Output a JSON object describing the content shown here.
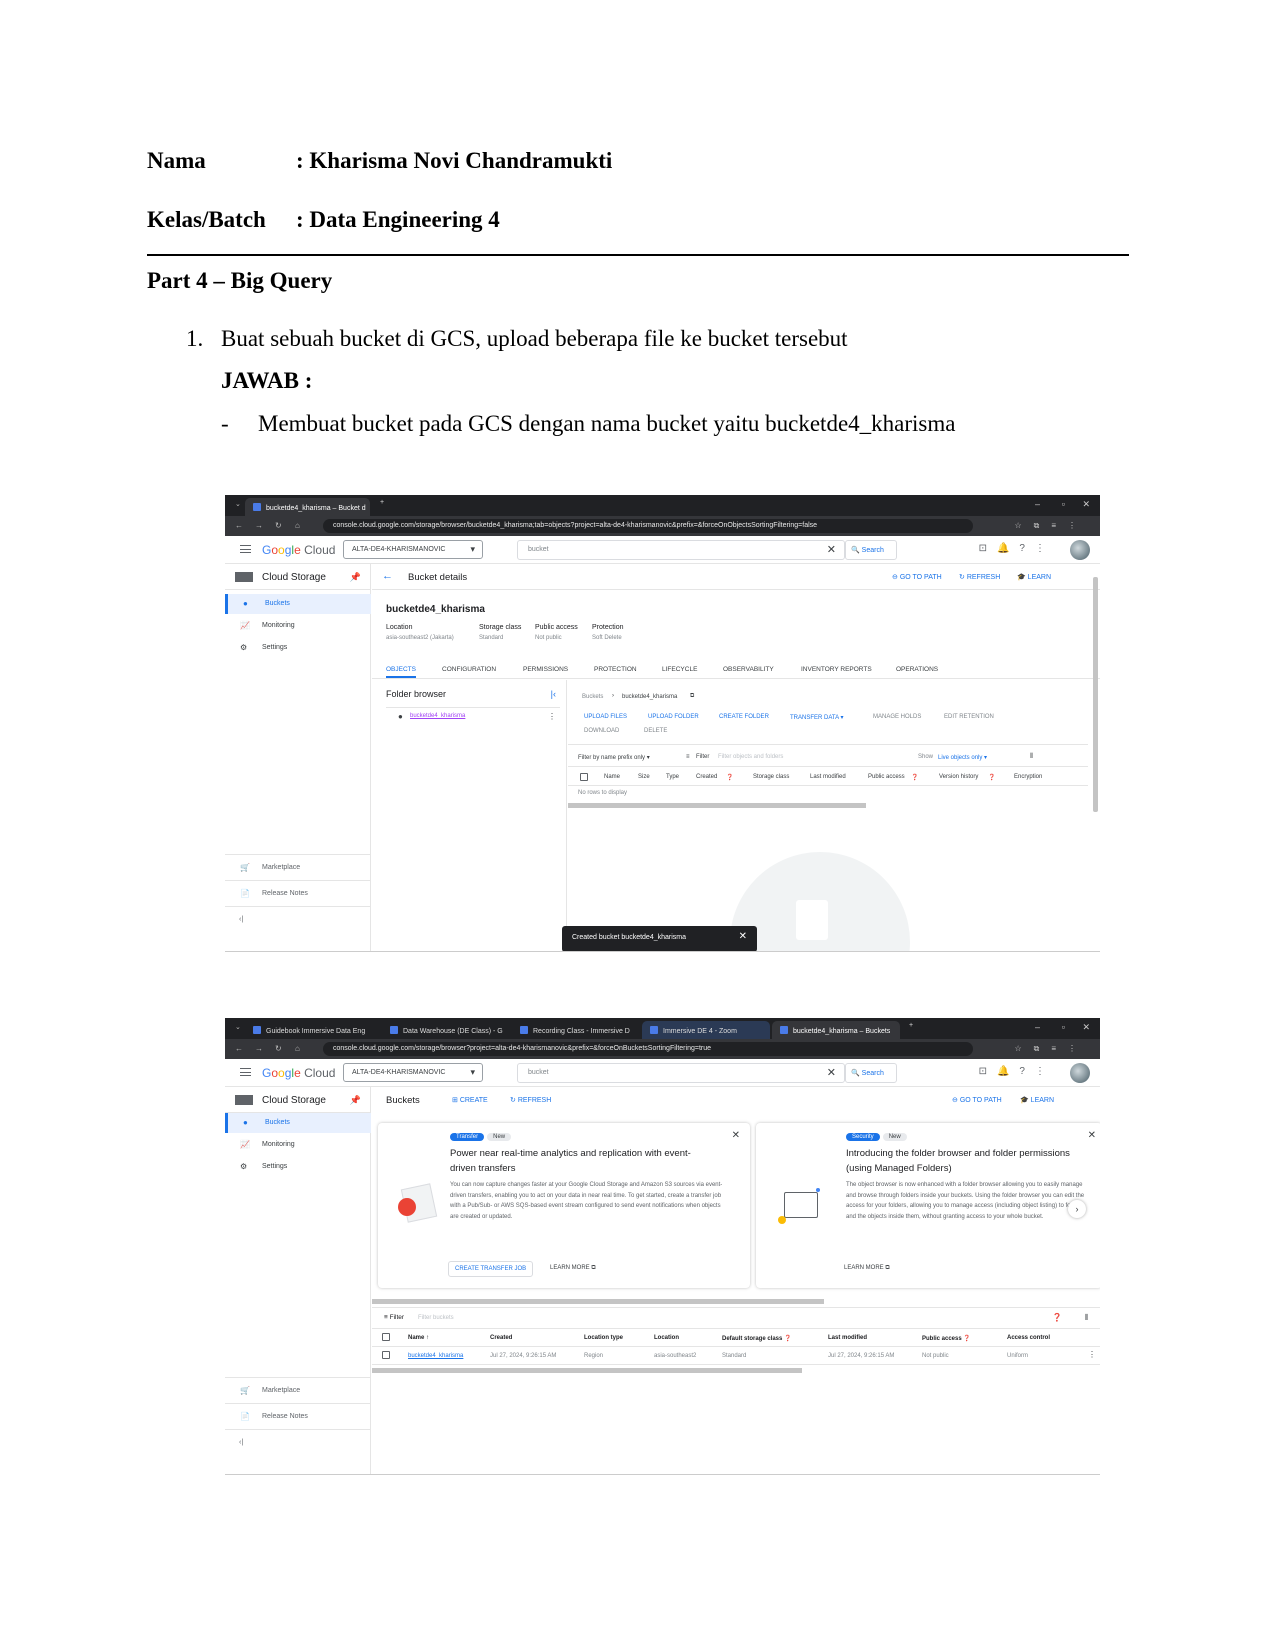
{
  "doc": {
    "nama_label": "Nama",
    "nama_value": ": Kharisma Novi Chandramukti",
    "kelas_label": "Kelas/Batch",
    "kelas_value": ": Data Engineering 4",
    "part_title": "Part 4 – Big Query",
    "item1_number": "1.",
    "item1_text": "Buat sebuah bucket di GCS, upload beberapa file ke bucket tersebut",
    "jawab": "JAWAB :",
    "bullet_dash": "-",
    "bullet_text": "Membuat bucket pada GCS dengan nama bucket yaitu bucketde4_kharisma"
  },
  "shot1": {
    "tab_title": "bucketde4_kharisma – Bucket d",
    "url": "console.cloud.google.com/storage/browser/bucketde4_kharisma;tab=objects?project=alta-de4-kharismanovic&prefix=&forceOnObjectsSortingFiltering=false",
    "project": "ALTA-DE4-KHARISMANOVIC",
    "search_placeholder": "bucket",
    "search_button": "Search",
    "product": "Cloud Storage",
    "nav": [
      "Buckets",
      "Monitoring",
      "Settings"
    ],
    "footer": [
      "Marketplace",
      "Release Notes"
    ],
    "page_title": "Bucket details",
    "goto_path": "GO TO PATH",
    "refresh": "REFRESH",
    "learn": "LEARN",
    "bucket_name": "bucketde4_kharisma",
    "props": [
      {
        "label": "Location",
        "value": "asia-southeast2 (Jakarta)"
      },
      {
        "label": "Storage class",
        "value": "Standard"
      },
      {
        "label": "Public access",
        "value": "Not public"
      },
      {
        "label": "Protection",
        "value": "Soft Delete"
      }
    ],
    "tabs": [
      "OBJECTS",
      "CONFIGURATION",
      "PERMISSIONS",
      "PROTECTION",
      "LIFECYCLE",
      "OBSERVABILITY",
      "INVENTORY REPORTS",
      "OPERATIONS"
    ],
    "folder_browser": "Folder browser",
    "folder_item": "bucketde4_kharisma",
    "breadcrumb_root": "Buckets",
    "breadcrumb_bucket": "bucketde4_kharisma",
    "actions": [
      "UPLOAD FILES",
      "UPLOAD FOLDER",
      "CREATE FOLDER",
      "TRANSFER DATA",
      "MANAGE HOLDS",
      "EDIT RETENTION",
      "DOWNLOAD",
      "DELETE"
    ],
    "filter_prefix": "Filter by name prefix only",
    "filter_label": "Filter",
    "filter_placeholder": "Filter objects and folders",
    "show_label": "Show",
    "show_value": "Live objects only",
    "columns": [
      "Name",
      "Size",
      "Type",
      "Created",
      "Storage class",
      "Last modified",
      "Public access",
      "Version history",
      "Encryption"
    ],
    "empty": "No rows to display",
    "toast": "Created bucket bucketde4_kharisma"
  },
  "shot2": {
    "tabs": [
      "Guidebook Immersive Data Eng",
      "Data Warehouse (DE Class) - G",
      "Recording Class - Immersive D",
      "Immersive DE 4 - Zoom",
      "bucketde4_kharisma – Buckets"
    ],
    "url": "console.cloud.google.com/storage/browser?project=alta-de4-kharismanovic&prefix=&forceOnBucketsSortingFiltering=true",
    "project": "ALTA-DE4-KHARISMANOVIC",
    "search_placeholder": "bucket",
    "search_button": "Search",
    "product": "Cloud Storage",
    "nav": [
      "Buckets",
      "Monitoring",
      "Settings"
    ],
    "footer": [
      "Marketplace",
      "Release Notes"
    ],
    "page_title": "Buckets",
    "create": "CREATE",
    "refresh": "REFRESH",
    "goto_path": "GO TO PATH",
    "learn": "LEARN",
    "card1": {
      "chip1": "Transfer",
      "chip2": "New",
      "title": "Power near real-time analytics and replication with event-driven transfers",
      "body": "You can now capture changes faster at your Google Cloud Storage and Amazon S3 sources via event-driven transfers, enabling you to act on your data in near real time. To get started, create a transfer job with a Pub/Sub- or AWS SQS-based event stream configured to send event notifications when objects are created or updated.",
      "btn1": "CREATE TRANSFER JOB",
      "btn2": "LEARN MORE"
    },
    "card2": {
      "chip1": "Security",
      "chip2": "New",
      "title": "Introducing the folder browser and folder permissions (using Managed Folders)",
      "body": "The object browser is now enhanced with a folder browser allowing you to easily manage and browse through folders inside your buckets. Using the folder browser you can edit the access for your folders, allowing you to manage access (including object listing) to folders and the objects inside them, without granting access to your whole bucket.",
      "btn": "LEARN MORE"
    },
    "filter_label": "Filter",
    "filter_placeholder": "Filter buckets",
    "columns": [
      "Name",
      "Created",
      "Location type",
      "Location",
      "Default storage class",
      "Last modified",
      "Public access",
      "Access control"
    ],
    "row": [
      "bucketde4_kharisma",
      "Jul 27, 2024, 9:26:15 AM",
      "Region",
      "asia-southeast2",
      "Standard",
      "Jul 27, 2024, 9:26:15 AM",
      "Not public",
      "Uniform"
    ]
  }
}
